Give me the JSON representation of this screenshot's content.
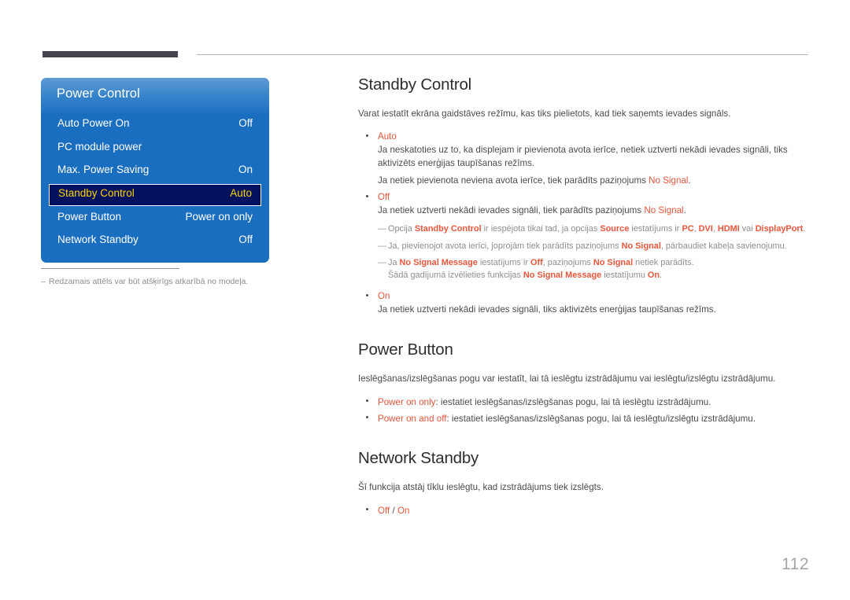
{
  "page": {
    "number": "112"
  },
  "osd": {
    "title": "Power Control",
    "rows": [
      {
        "label": "Auto Power On",
        "value": "Off",
        "selected": false
      },
      {
        "label": "PC module power",
        "value": "",
        "selected": false
      },
      {
        "label": "Max. Power Saving",
        "value": "On",
        "selected": false
      },
      {
        "label": "Standby Control",
        "value": "Auto",
        "selected": true
      },
      {
        "label": "Power Button",
        "value": "Power on only",
        "selected": false
      },
      {
        "label": "Network Standby",
        "value": "Off",
        "selected": false
      }
    ],
    "footnote_dash": "‒",
    "footnote": "Redzamais attēls var būt atšķirīgs atkarībā no modeļa."
  },
  "sections": {
    "standby_control": {
      "title": "Standby Control",
      "intro": "Varat iestatīt ekrāna gaidstāves režīmu, kas tiks pielietots, kad tiek saņemts ievades signāls.",
      "bullet_auto_head": "Auto",
      "bullet_auto_body1": "Ja neskatoties uz to, ka displejam ir pievienota avota ierīce, netiek uztverti nekādi ievades signāli, tiks aktivizēts enerģijas taupīšanas režīms.",
      "bullet_auto_body2_pre": "Ja netiek pievienota neviena avota ierīce, tiek parādīts paziņojums ",
      "bullet_auto_body2_hl": "No Signal",
      "bullet_auto_body2_post": ".",
      "bullet_off_head": "Off",
      "bullet_off_body_pre": "Ja netiek uztverti nekādi ievades signāli, tiek parādīts paziņojums ",
      "bullet_off_body_hl": "No Signal",
      "bullet_off_body_post": ".",
      "note1_p1": "Opcija ",
      "note1_b1": "Standby Control",
      "note1_p2": " ir iespējota tikai tad, ja opcijas ",
      "note1_b2": "Source",
      "note1_p3": " iestatījums ir ",
      "note1_b3": "PC",
      "note1_p4": ", ",
      "note1_b4": "DVI",
      "note1_p5": ", ",
      "note1_b5": "HDMI",
      "note1_p6": " vai ",
      "note1_b6": "DisplayPort",
      "note1_p7": ".",
      "note2_p1": "Ja, pievienojot avota ierīci, joprojām tiek parādīts paziņojums ",
      "note2_b1": "No Signal",
      "note2_p2": ", pārbaudiet kabeļa savienojumu.",
      "note3_p1": "Ja ",
      "note3_b1": "No Signal Message",
      "note3_p2": " iestatījums ir ",
      "note3_b2": "Off",
      "note3_p3": ", paziņojums ",
      "note3_b3": "No Signal",
      "note3_p4": " netiek parādīts.",
      "note3_line2_p1": "Šādā gadījumā izvēlieties funkcijas ",
      "note3_line2_b1": "No Signal Message",
      "note3_line2_p2": " iestatījumu ",
      "note3_line2_b2": "On",
      "note3_line2_p3": ".",
      "bullet_on_head": "On",
      "bullet_on_body": "Ja netiek uztverti nekādi ievades signāli, tiks aktivizēts enerģijas taupīšanas režīms."
    },
    "power_button": {
      "title": "Power Button",
      "intro": "Ieslēgšanas/izslēgšanas pogu var iestatīt, lai tā ieslēgtu izstrādājumu vai ieslēgtu/izslēgtu izstrādājumu.",
      "item1_hl": "Power on only",
      "item1_rest": ": iestatiet ieslēgšanas/izslēgšanas pogu, lai tā ieslēgtu izstrādājumu.",
      "item2_hl": "Power on and off",
      "item2_rest": ": iestatiet ieslēgšanas/izslēgšanas pogu, lai tā ieslēgtu/izslēgtu izstrādājumu."
    },
    "network_standby": {
      "title": "Network Standby",
      "intro": "Šī funkcija atstāj tīklu ieslēgtu, kad izstrādājums tiek izslēgts.",
      "item1_a": "Off",
      "item1_sep": " / ",
      "item1_b": "On"
    }
  },
  "colors": {
    "accent": "#e8563c",
    "menu_blue": "#1a6ec0",
    "menu_selected_bg": "#02115e",
    "menu_selected_text": "#ffd200",
    "header_bar": "#45414f",
    "page_number": "#a5a5aa"
  }
}
